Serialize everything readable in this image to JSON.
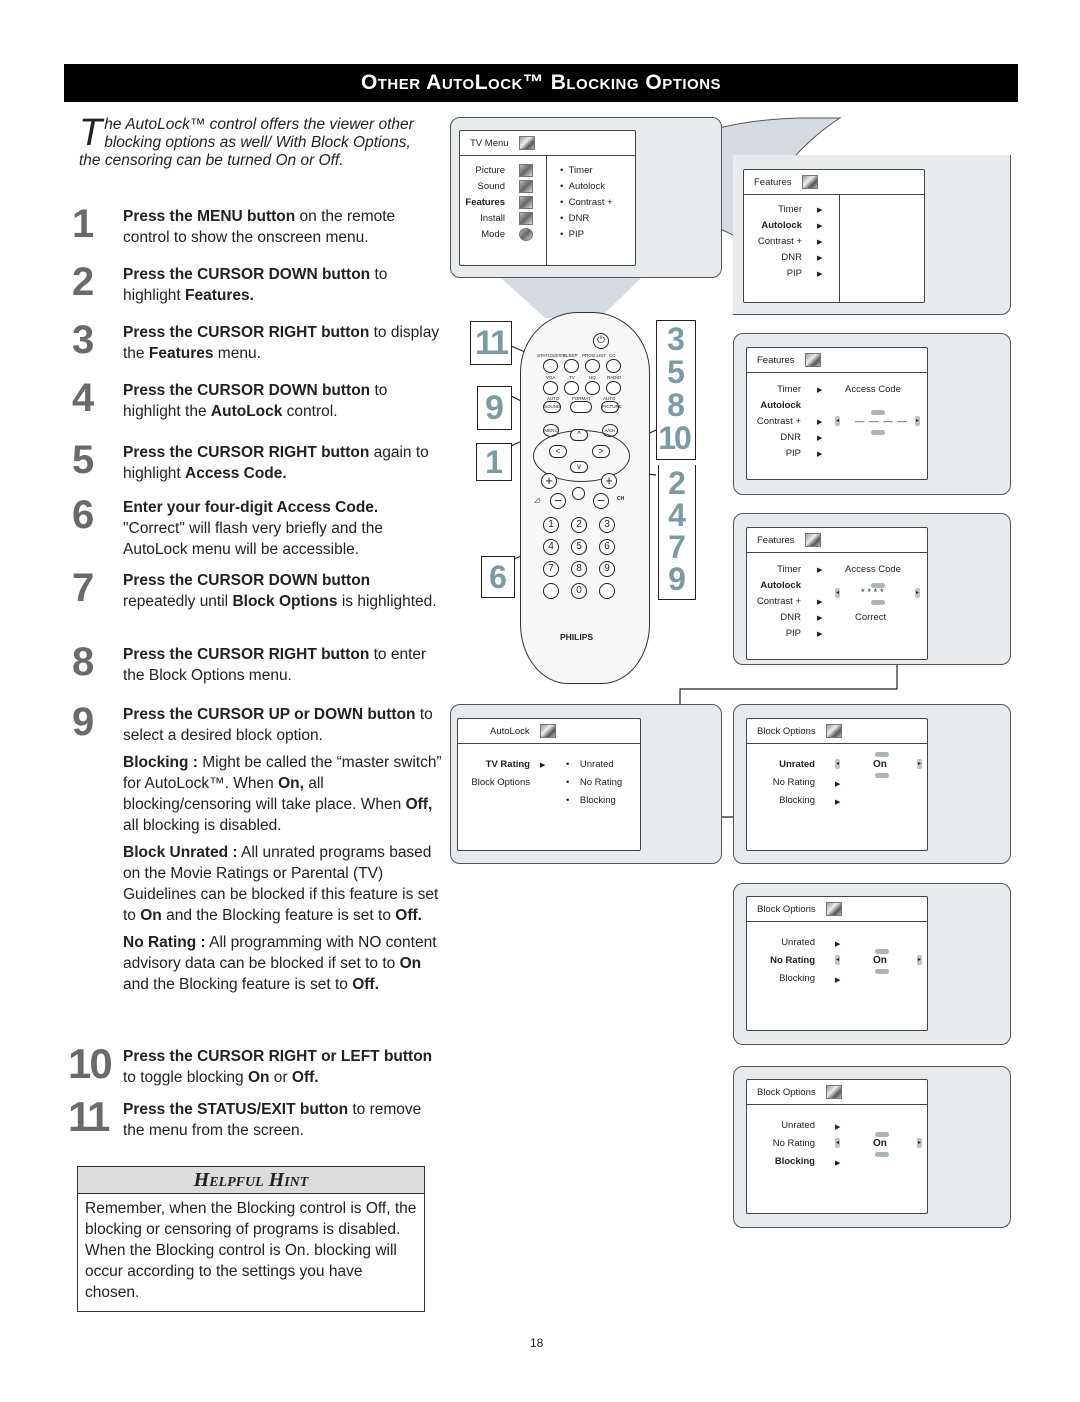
{
  "banner": {
    "title": "Other AutoLock™ Blocking Options"
  },
  "intro": {
    "dropcap": "T",
    "text": "he AutoLock™ control offers the viewer other blocking options as well/  With Block Options, the censoring can be turned On or Off."
  },
  "steps": [
    {
      "num": "1",
      "bold": "Press the MENU button",
      "rest": " on the remote control to show the onscreen menu."
    },
    {
      "num": "2",
      "bold": "Press the CURSOR DOWN button",
      "rest": " to highlight ",
      "bold2": "Features."
    },
    {
      "num": "3",
      "bold": "Press the CURSOR RIGHT button",
      "rest": " to display the ",
      "bold2": "Features",
      "rest2": " menu."
    },
    {
      "num": "4",
      "bold": "Press the CURSOR DOWN button",
      "rest": " to highlight the ",
      "bold2": "AutoLock",
      "rest2": "  control."
    },
    {
      "num": "5",
      "bold": "Press the CURSOR RIGHT button",
      "rest": " again to highlight ",
      "bold2": "Access Code."
    },
    {
      "num": "6",
      "bold": "Enter your four-digit Access Code.",
      "rest": " \"Correct\" will flash very briefly and the AutoLock menu will be accessible."
    },
    {
      "num": "7",
      "bold": "Press the CURSOR DOWN button",
      "rest": " repeatedly until ",
      "bold2": "Block Options",
      "rest2": " is highlighted."
    },
    {
      "num": "8",
      "bold": "Press the CURSOR RIGHT button",
      "rest": " to enter the Block Options menu."
    },
    {
      "num": "9",
      "bold": "Press the CURSOR UP or DOWN button",
      "rest": " to select a desired block option."
    },
    {
      "num": "10",
      "bold": "Press the CURSOR RIGHT or LEFT button",
      "rest": " to toggle blocking ",
      "bold2": "On",
      "rest2": " or ",
      "bold3": "Off."
    },
    {
      "num": "11",
      "bold": "Press the STATUS/EXIT button",
      "rest": " to remove the menu from the screen."
    }
  ],
  "step9_details": [
    {
      "term": "Blocking :",
      "p1": " Might be called the “master switch” for AutoLock™. When ",
      "b1": "On,",
      "p2": " all blocking/censoring will take place. When ",
      "b2": "Off,",
      "p3": " all  blocking is disabled."
    },
    {
      "term": "Block Unrated :",
      "p1": " All unrated programs based on the Movie Ratings or Parental (TV) Guidelines can be blocked if this feature is set to ",
      "b1": "On",
      "p2": " and the Blocking feature is set to ",
      "b2": "Off.",
      "p3": ""
    },
    {
      "term": "No Rating :",
      "p1": " All programming with NO content advisory data can be blocked if set to to ",
      "b1": "On",
      "p2": " and the Blocking feature is set to ",
      "b2": "Off.",
      "p3": ""
    }
  ],
  "hint": {
    "title": "Helpful Hint",
    "text": "Remember, when the Blocking control is Off, the blocking or censoring of programs is disabled.  When the Blocking control is On. blocking will occur according to the settings you have chosen."
  },
  "page_number": "18",
  "tv_menu": {
    "title": "TV Menu",
    "left": [
      "Picture",
      "Sound",
      "Features",
      "Install",
      "Mode"
    ],
    "highlighted": "Features",
    "right": [
      "Timer",
      "Autolock",
      "Contrast +",
      "DNR",
      "PIP"
    ]
  },
  "features_menu": {
    "title": "Features",
    "items": [
      "Timer",
      "Autolock",
      "Contrast +",
      "DNR",
      "PIP"
    ],
    "highlighted": "Autolock",
    "access_code_label": "Access Code",
    "code_empty": "— — — —",
    "code_entered": "* * * *",
    "correct": "Correct"
  },
  "autolock_menu": {
    "title": "AutoLock",
    "left": [
      "TV Rating",
      "Block Options"
    ],
    "highlighted": "TV Rating",
    "right": [
      "Unrated",
      "No Rating",
      "Blocking"
    ]
  },
  "block_options_menu": {
    "title": "Block Options",
    "items": [
      "Unrated",
      "No Rating",
      "Blocking"
    ],
    "value": "On",
    "screens": [
      {
        "highlighted": "Unrated",
        "selector_row": 0
      },
      {
        "highlighted": "No Rating",
        "selector_row": 1
      },
      {
        "highlighted": "Blocking",
        "selector_row": 1
      }
    ]
  },
  "remote": {
    "brand": "PHILIPS",
    "top_labels": [
      "STATUS/EXIT",
      "SLEEP",
      "PROG.LIST",
      "CC"
    ],
    "mid_labels": [
      "VGA",
      "TV",
      "HQ",
      "RADIO"
    ],
    "auto_labels": [
      "AUTO",
      "FORMAT",
      "AUTO"
    ],
    "auto_buttons": [
      "SOUND",
      "",
      "PICTURE"
    ],
    "menu": "MENU",
    "av": "A/CH",
    "vol_label": "◿",
    "ch_label": "CH",
    "digits": [
      "1",
      "2",
      "3",
      "4",
      "5",
      "6",
      "7",
      "8",
      "9",
      "0"
    ],
    "callouts_left": [
      "11",
      "9",
      "1",
      "6"
    ],
    "callouts_right_top": [
      "3",
      "5",
      "8",
      "10"
    ],
    "callouts_right_bottom": [
      "2",
      "4",
      "7",
      "9"
    ]
  },
  "colors": {
    "callout_text": "#7d9aa3",
    "panel_bg": "#e8ebee",
    "banner_bg": "#000000",
    "hint_header": "#dcdcdc"
  }
}
